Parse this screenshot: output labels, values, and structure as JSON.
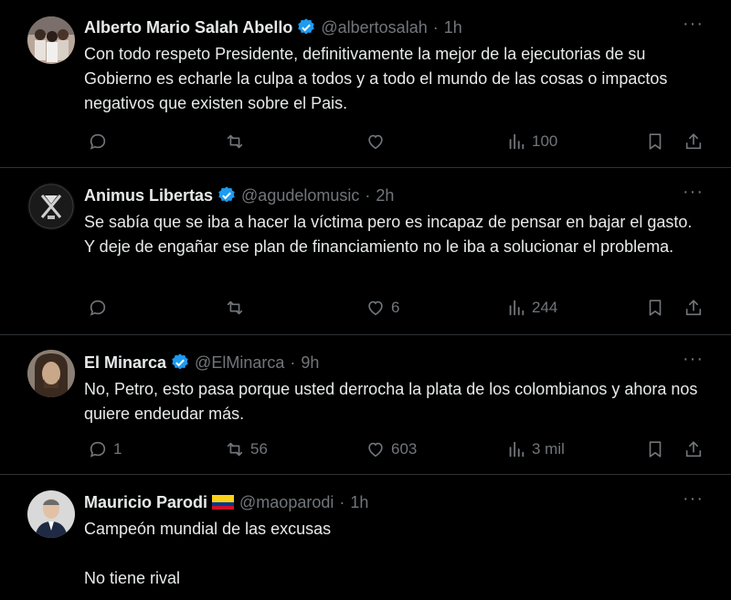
{
  "tweets": [
    {
      "name": "Alberto Mario Salah Abello",
      "handle": "@albertosalah",
      "time": "1h",
      "text": "Con todo respeto Presidente, definitivamente la mejor de la ejecutorias de su Gobierno es echarle la culpa a todos y a todo el mundo de las cosas o impactos negativos que existen sobre el Pais.",
      "replies": "",
      "retweets": "",
      "likes": "",
      "views": "100"
    },
    {
      "name": "Animus Libertas",
      "handle": "@agudelomusic",
      "time": "2h",
      "text": "Se sabía que se iba a hacer la víctima pero es incapaz de pensar en bajar el gasto. Y deje de engañar ese plan de financiamiento no le iba a solucionar el problema.",
      "replies": "",
      "retweets": "",
      "likes": "6",
      "views": "244"
    },
    {
      "name": "El Minarca",
      "handle": "@ElMinarca",
      "time": "9h",
      "text": "No, Petro, esto pasa porque usted derrocha la plata de los colombianos y ahora nos quiere endeudar más.",
      "replies": "1",
      "retweets": "56",
      "likes": "603",
      "views": "3 mil"
    },
    {
      "name": "Mauricio Parodi",
      "handle": "@maoparodi",
      "time": "1h",
      "text": "Campeón mundial de las excusas\n\nNo tiene rival"
    }
  ],
  "colors": {
    "background": "#000000",
    "text": "#e7e9ea",
    "muted": "#71767b",
    "divider": "#2f3336",
    "verified": "#1d9bf0"
  },
  "icons": [
    "verified-badge-icon",
    "more-icon",
    "reply-icon",
    "retweet-icon",
    "like-icon",
    "views-icon",
    "bookmark-icon",
    "share-icon",
    "colombia-flag-icon"
  ]
}
